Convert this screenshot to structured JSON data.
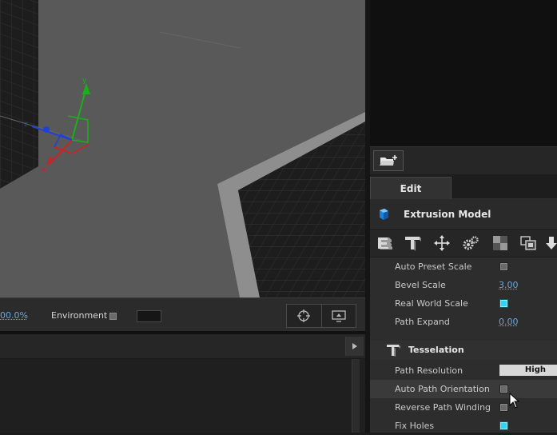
{
  "viewport": {
    "axis_labels": {
      "x": "x",
      "y": "y",
      "z": "z"
    }
  },
  "status_bar": {
    "zoom_text": "00.0%",
    "environment_label": "Environment",
    "environment_checked": false
  },
  "panel": {
    "tab_label": "Edit",
    "model_title": "Extrusion Model",
    "tools": [
      "extrude-icon",
      "text-tool-icon",
      "move-icon",
      "gears-icon",
      "material-icon",
      "layers-icon",
      "download-icon"
    ]
  },
  "properties": [
    {
      "label": "Auto Preset Scale",
      "type": "checkbox",
      "checked": false
    },
    {
      "label": "Bevel Scale",
      "type": "number",
      "value": "3.00"
    },
    {
      "label": "Real World Scale",
      "type": "checkbox",
      "checked": true
    },
    {
      "label": "Path Expand",
      "type": "number",
      "value": "0.00"
    }
  ],
  "tesselation": {
    "section_title": "Tesselation",
    "rows": [
      {
        "label": "Path Resolution",
        "type": "select",
        "value": "High"
      },
      {
        "label": "Auto Path Orientation",
        "type": "checkbox",
        "checked": false
      },
      {
        "label": "Reverse Path Winding",
        "type": "checkbox",
        "checked": false
      },
      {
        "label": "Fix Holes",
        "type": "checkbox",
        "checked": true
      }
    ]
  },
  "colors": {
    "accent_link": "#6ea6df",
    "checkbox_on": "#2fd3f5",
    "axis_x": "#d32020",
    "axis_y": "#19b019",
    "axis_z": "#2040d8"
  }
}
